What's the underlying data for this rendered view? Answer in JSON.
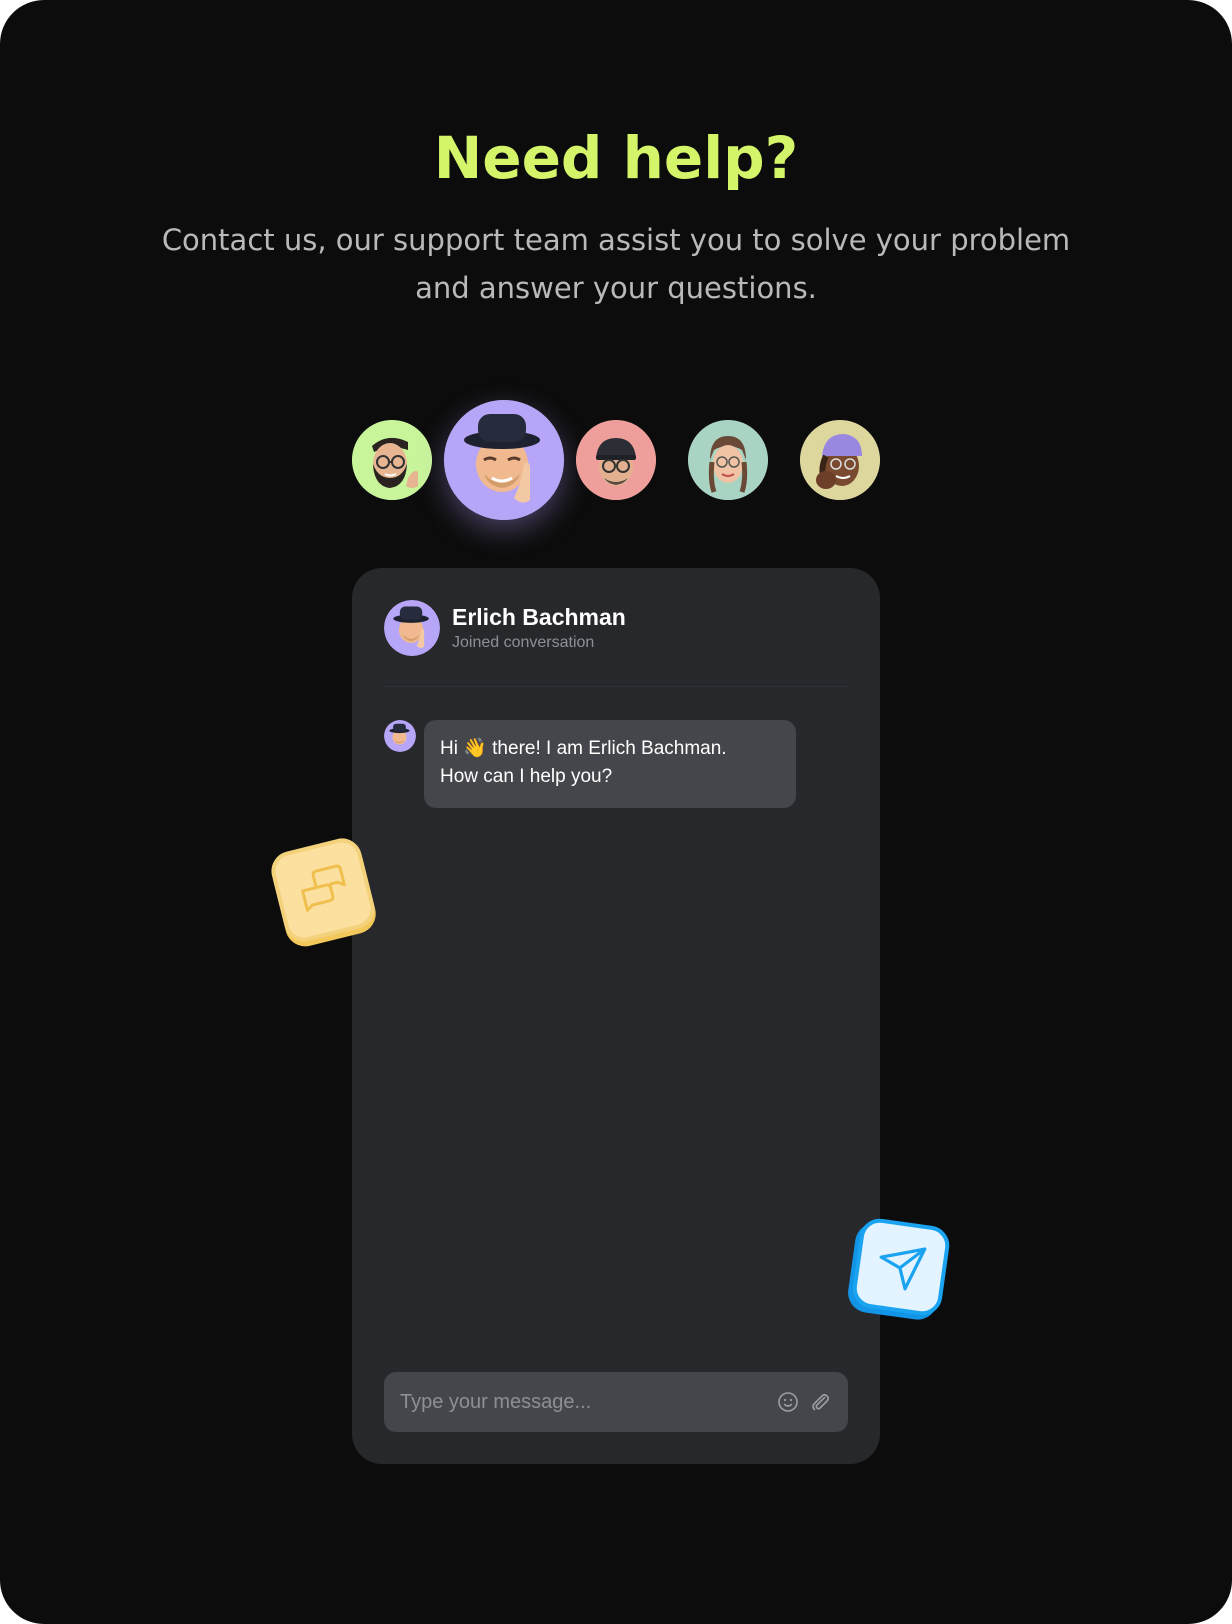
{
  "hero": {
    "title": "Need help?",
    "subtitle_lines": [
      "Contact us, our support team assist you to solve your problem",
      "and answer your questions."
    ]
  },
  "avatars": [
    {
      "name": "support-avatar-1",
      "bg": "#c8f59a",
      "active": false
    },
    {
      "name": "support-avatar-2",
      "bg": "#b7a6f7",
      "active": true
    },
    {
      "name": "support-avatar-3",
      "bg": "#ef9f9b",
      "active": false
    },
    {
      "name": "support-avatar-4",
      "bg": "#a9d3c2",
      "active": false
    },
    {
      "name": "support-avatar-5",
      "bg": "#ddd79e",
      "active": false
    }
  ],
  "chat": {
    "agent_name": "Erlich Bachman",
    "agent_status": "Joined conversation",
    "message_lines": [
      "Hi 👋 there! I am Erlich Bachman.",
      "How can I help you?"
    ],
    "input_placeholder": "Type your message...",
    "icons": {
      "emoji": "smile-icon",
      "attach": "paperclip-icon"
    }
  },
  "badges": {
    "chat_icon": "chat-bubbles-icon",
    "send_icon": "send-icon"
  },
  "colors": {
    "accent": "#d4f56a",
    "background": "#0c0c0c",
    "panel": "#27282c",
    "bubble": "#45464b",
    "badge_yellow": "#fbe0a0",
    "badge_blue": "#1aa3f0"
  }
}
